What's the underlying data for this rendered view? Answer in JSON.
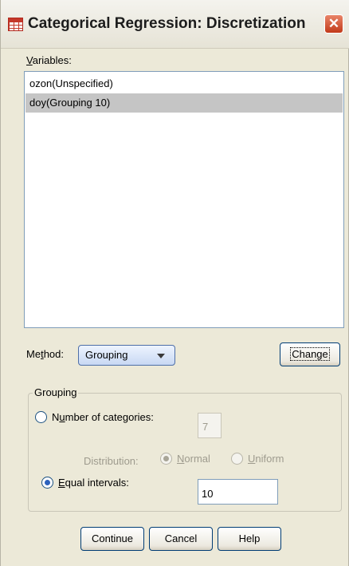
{
  "window": {
    "title": "Categorical Regression: Discretization",
    "close_icon": "close-icon"
  },
  "variables": {
    "label": "Variables:",
    "items": [
      {
        "text": "ozon(Unspecified)",
        "selected": false
      },
      {
        "text": "doy(Grouping 10)",
        "selected": true
      }
    ]
  },
  "method": {
    "label": "Method:",
    "value": "Grouping",
    "change_button": "Change"
  },
  "grouping": {
    "title": "Grouping",
    "number_of_categories": {
      "label": "Number of categories:",
      "checked": false,
      "value": "7"
    },
    "distribution": {
      "label": "Distribution:",
      "normal": "Normal",
      "uniform": "Uniform",
      "selected": "Normal"
    },
    "equal_intervals": {
      "label": "Equal intervals:",
      "checked": true,
      "value": "10"
    }
  },
  "buttons": {
    "continue": "Continue",
    "cancel": "Cancel",
    "help": "Help"
  }
}
